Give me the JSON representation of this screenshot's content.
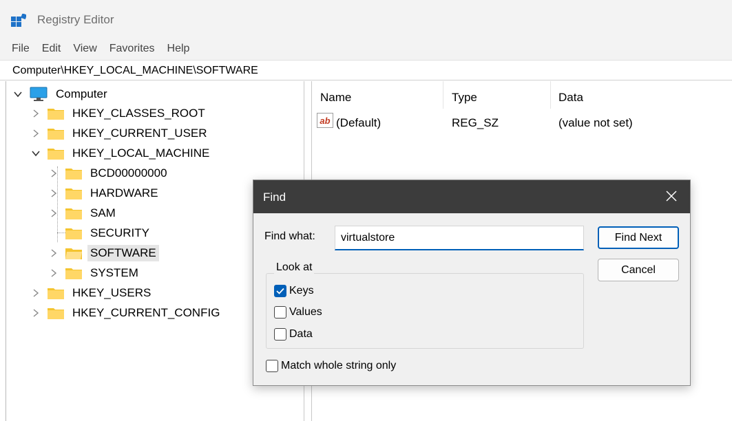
{
  "app": {
    "title": "Registry Editor"
  },
  "menu": [
    "File",
    "Edit",
    "View",
    "Favorites",
    "Help"
  ],
  "address": "Computer\\HKEY_LOCAL_MACHINE\\SOFTWARE",
  "tree": {
    "root": "Computer",
    "hives": [
      "HKEY_CLASSES_ROOT",
      "HKEY_CURRENT_USER",
      "HKEY_LOCAL_MACHINE",
      "HKEY_USERS",
      "HKEY_CURRENT_CONFIG"
    ],
    "hklm_children": [
      "BCD00000000",
      "HARDWARE",
      "SAM",
      "SECURITY",
      "SOFTWARE",
      "SYSTEM"
    ],
    "selected": "SOFTWARE"
  },
  "list": {
    "columns": [
      "Name",
      "Type",
      "Data"
    ],
    "rows": [
      {
        "name": "(Default)",
        "type": "REG_SZ",
        "data": "(value not set)"
      }
    ]
  },
  "find_dialog": {
    "title": "Find",
    "find_what_label": "Find what:",
    "find_what_value": "virtualstore",
    "find_next_label": "Find Next",
    "cancel_label": "Cancel",
    "look_at_label": "Look at",
    "options": [
      {
        "label": "Keys",
        "checked": true
      },
      {
        "label": "Values",
        "checked": false
      },
      {
        "label": "Data",
        "checked": false
      }
    ],
    "match_whole_label": "Match whole string only",
    "match_whole_checked": false
  },
  "colors": {
    "accent": "#005fb8",
    "folder": "#f4c430",
    "dialog_title_bg": "#3c3c3c"
  }
}
